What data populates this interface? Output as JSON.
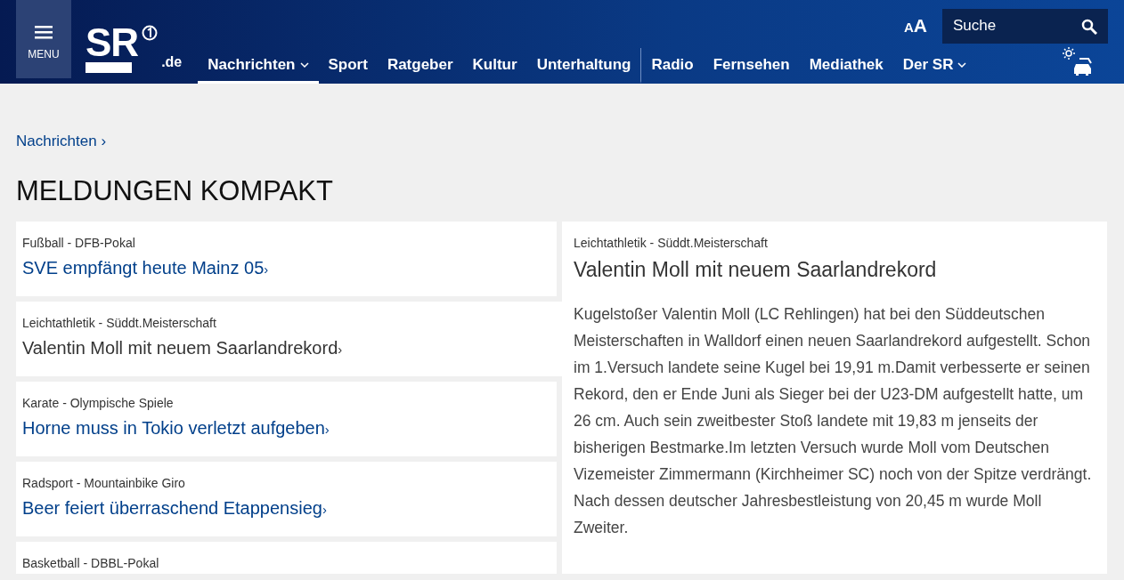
{
  "header": {
    "menu_label": "MENU",
    "logo": {
      "text": "SR",
      "suffix": ".de"
    },
    "nav": [
      {
        "label": "Nachrichten",
        "selected": true,
        "dropdown": true,
        "separator_after": false
      },
      {
        "label": "Sport",
        "selected": false,
        "dropdown": false,
        "separator_after": false
      },
      {
        "label": "Ratgeber",
        "selected": false,
        "dropdown": false,
        "separator_after": false
      },
      {
        "label": "Kultur",
        "selected": false,
        "dropdown": false,
        "separator_after": false
      },
      {
        "label": "Unterhaltung",
        "selected": false,
        "dropdown": false,
        "separator_after": true
      },
      {
        "label": "Radio",
        "selected": false,
        "dropdown": false,
        "separator_after": false
      },
      {
        "label": "Fernsehen",
        "selected": false,
        "dropdown": false,
        "separator_after": false
      },
      {
        "label": "Mediathek",
        "selected": false,
        "dropdown": false,
        "separator_after": false
      },
      {
        "label": "Der SR",
        "selected": false,
        "dropdown": true,
        "separator_after": false
      }
    ],
    "font_size_small": "A",
    "font_size_large": "A",
    "search": {
      "placeholder": "Suche"
    }
  },
  "breadcrumb": {
    "label": "Nachrichten",
    "arrow": "›"
  },
  "heading": "MELDUNGEN KOMPAKT",
  "items": [
    {
      "topic": "Fußball - DFB-Pokal",
      "title": "SVE empfängt heute Mainz 05",
      "arrow": "›",
      "selected": false
    },
    {
      "topic": "Leichtathletik - Süddt.Meisterschaft",
      "title": "Valentin Moll mit neuem Saarlandrekord",
      "arrow": "›",
      "selected": true
    },
    {
      "topic": "Karate - Olympische Spiele",
      "title": "Horne muss in Tokio verletzt aufgeben",
      "arrow": "›",
      "selected": false
    },
    {
      "topic": "Radsport - Mountainbike Giro",
      "title": "Beer feiert überraschend Etappensieg",
      "arrow": "›",
      "selected": false
    },
    {
      "topic": "Basketball - DBBL-Pokal",
      "selected": false
    }
  ],
  "detail": {
    "topic": "Leichtathletik - Süddt.Meisterschaft",
    "title": "Valentin Moll mit neuem Saarlandrekord",
    "text": "Kugelstoßer Valentin Moll (LC Rehlingen) hat bei den Süddeutschen Meisterschaften in Walldorf einen neuen Saarlandrekord aufgestellt. Schon im 1.Versuch landete seine Kugel bei 19,91 m.Damit verbesserte er seinen Rekord, den er Ende Juni als Sieger bei der U23-DM aufgestellt hatte, um 26 cm. Auch sein zweitbester Stoß landete mit 19,83 m jenseits der bisherigen Bestmarke.Im letzten Versuch wurde Moll vom Deutschen Vizemeister Zimmermann (Kirchheimer SC) noch von der Spitze verdrängt. Nach dessen deutscher Jahresbestleistung von 20,45 m wurde Moll Zweiter."
  }
}
